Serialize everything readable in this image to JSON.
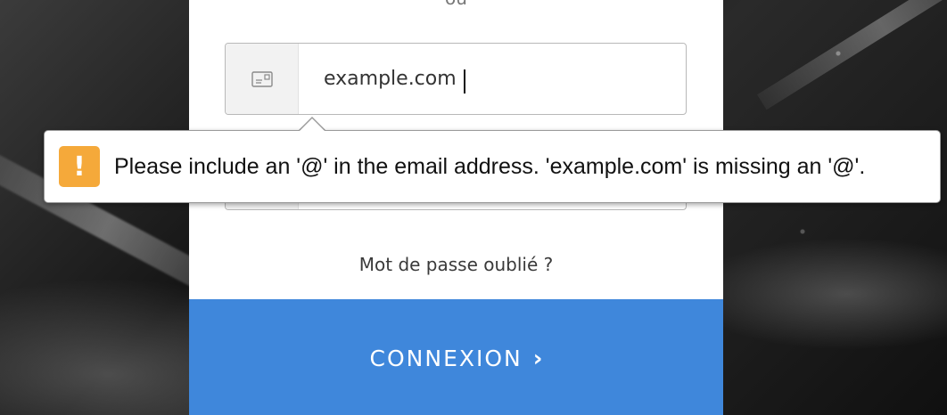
{
  "divider_text": "ou",
  "email_field": {
    "value": "example.com",
    "icon": "envelope-card-icon"
  },
  "password_field": {
    "icon": "lock-icon"
  },
  "forgot_link": "Mot de passe oublié ?",
  "submit": {
    "label": "CONNEXION",
    "chevron": "›"
  },
  "validation_tooltip": {
    "icon_glyph": "!",
    "message": "Please include an '@' in the email address. 'example.com' is missing an '@'."
  },
  "colors": {
    "button": "#3f87db",
    "warning": "#f5a93a"
  }
}
